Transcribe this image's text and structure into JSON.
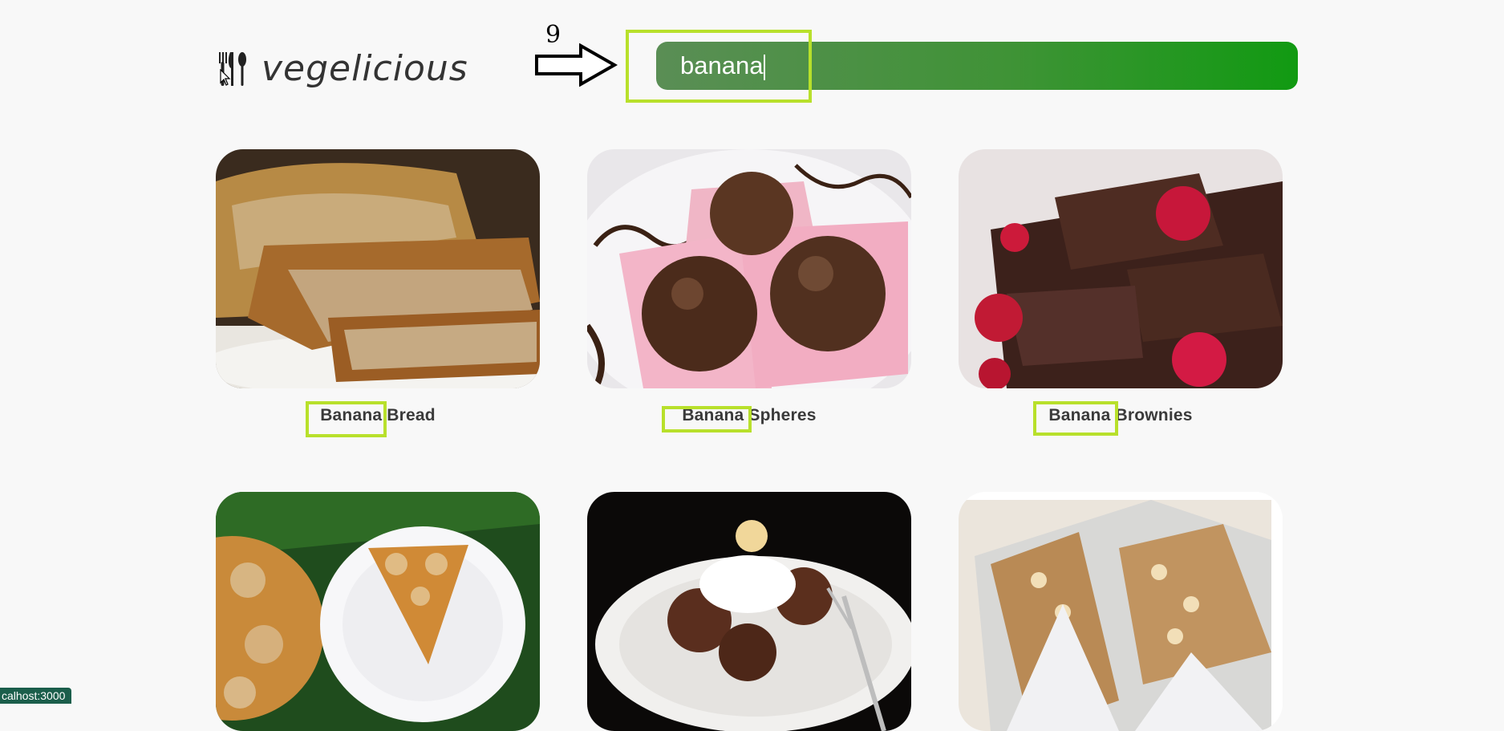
{
  "brand": {
    "name": "vegelicious",
    "icon": "fork-spoon-icon"
  },
  "annotation": {
    "step_number": "9"
  },
  "search": {
    "value": "banana",
    "placeholder": ""
  },
  "colors": {
    "accent_highlight": "#b8e02b",
    "search_gradient_start": "#5a8e55",
    "search_gradient_end": "#119a12",
    "status_bg": "#1b5e4b"
  },
  "recipes": [
    {
      "title_match": "Banana",
      "title_rest": " Bread"
    },
    {
      "title_match": "Banana",
      "title_rest": " Spheres"
    },
    {
      "title_match": "Banana",
      "title_rest": " Brownies"
    },
    {
      "title_match": "",
      "title_rest": ""
    },
    {
      "title_match": "",
      "title_rest": ""
    },
    {
      "title_match": "",
      "title_rest": ""
    }
  ],
  "status_bar": {
    "url": "calhost:3000"
  }
}
